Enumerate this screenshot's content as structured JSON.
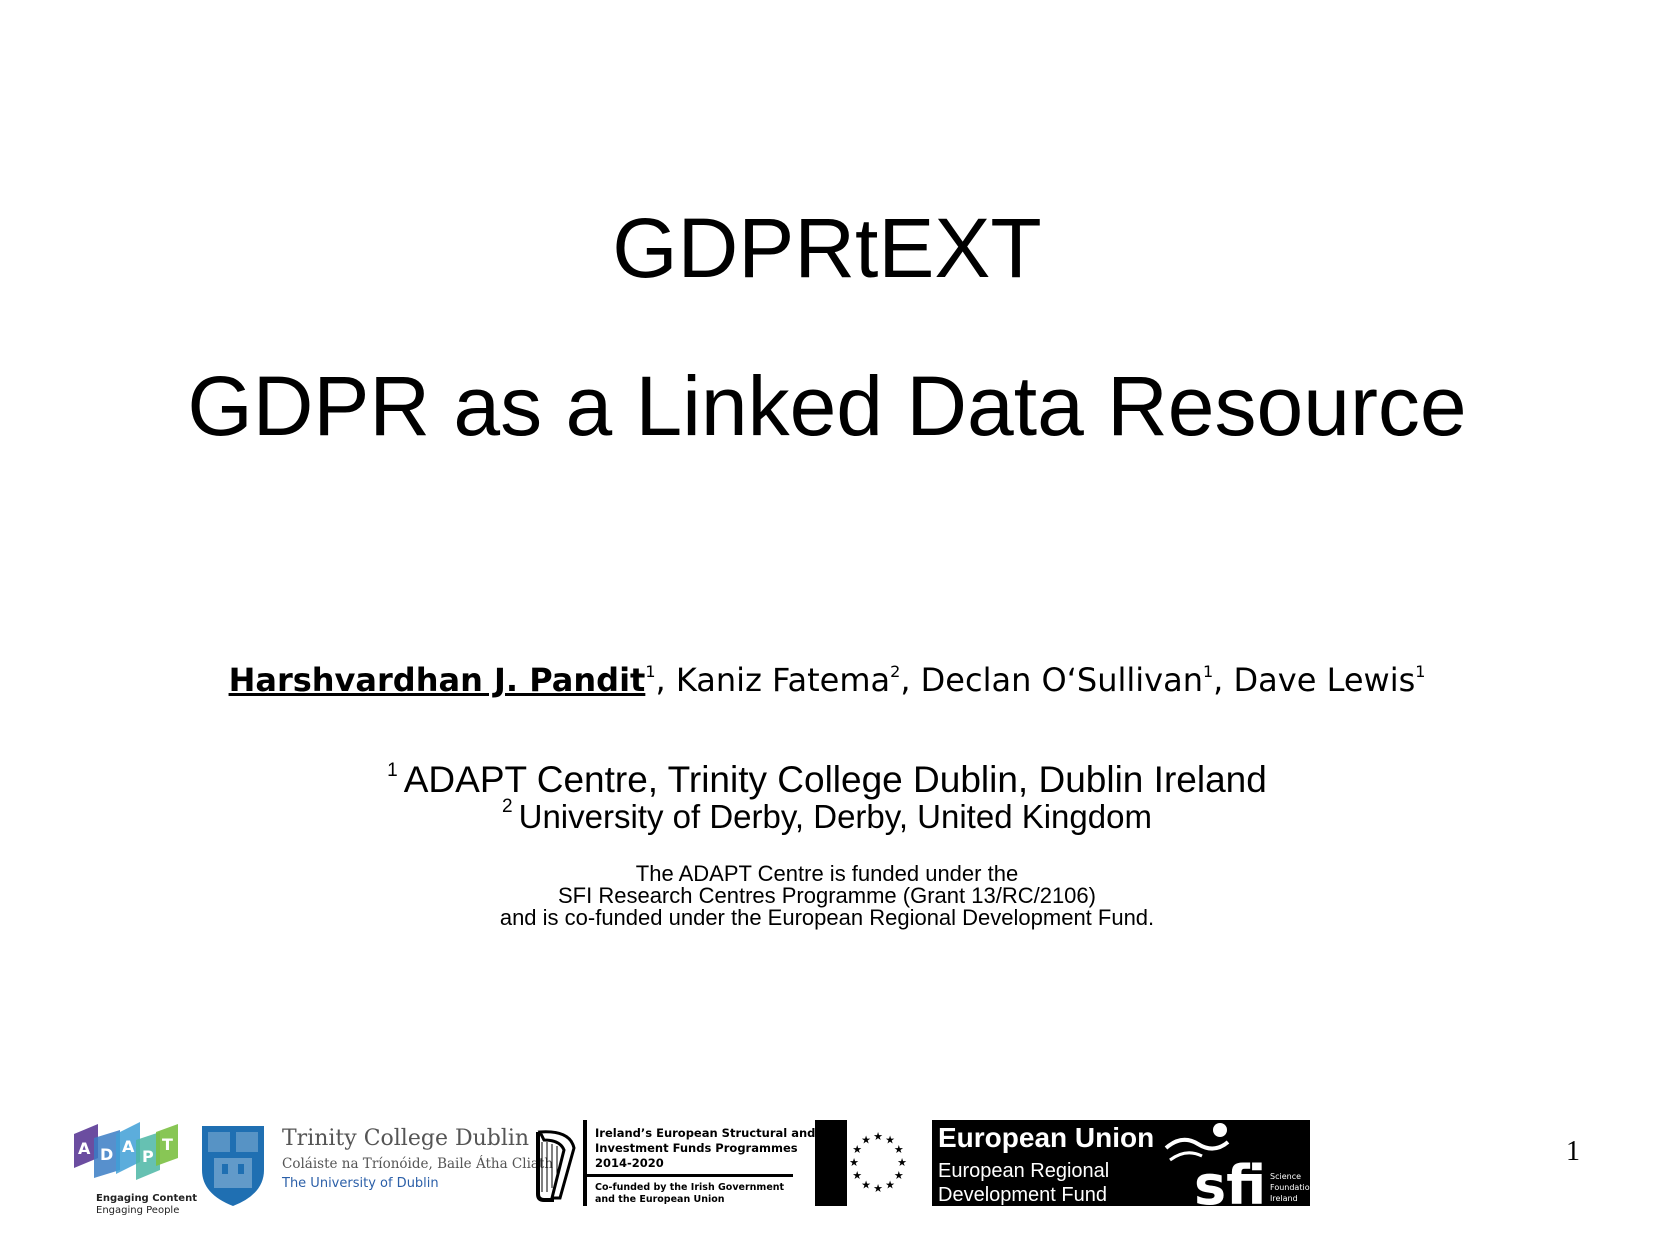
{
  "slide": {
    "title_line1": "GDPRtEXT",
    "title_line2": "GDPR as a Linked Data Resource",
    "authors": [
      {
        "name": "Harshvardhan J. Pandit",
        "affil": "1",
        "sep": ", "
      },
      {
        "name": "Kaniz Fatema",
        "affil": "2",
        "sep": ", "
      },
      {
        "name": "Declan O‘Sullivan",
        "affil": "1",
        "sep": ", "
      },
      {
        "name": "Dave Lewis",
        "affil": "1",
        "sep": ""
      }
    ],
    "affiliations": [
      {
        "marker": "1",
        "text": "ADAPT Centre, Trinity College Dublin, Dublin Ireland"
      },
      {
        "marker": "2",
        "text": "University of Derby, Derby, United Kingdom"
      }
    ],
    "funding": [
      "The ADAPT Centre is funded under the",
      "SFI Research Centres Programme (Grant 13/RC/2106)",
      "and is co-funded under the European Regional Development Fund."
    ],
    "page_number": "1"
  },
  "logos": {
    "adapt": {
      "letters": [
        "A",
        "D",
        "A",
        "P",
        "T"
      ],
      "tagline1": "Engaging Content",
      "tagline2": "Engaging People"
    },
    "tcd": {
      "name": "Trinity College Dublin",
      "irish": "Coláiste na Tríonóide, Baile Átha Cliath",
      "university": "The University of Dublin"
    },
    "esif": {
      "line1": "Ireland’s European Structural and",
      "line2": "Investment Funds Programmes",
      "line3": "2014-2020",
      "line4": "Co-funded by the Irish Government",
      "line5": "and the European Union"
    },
    "erdf": {
      "title": "European Union",
      "line1": "European Regional",
      "line2": "Development Fund"
    },
    "sfi": {
      "wordmark": "sfi",
      "line1": "Science",
      "line2": "Foundation",
      "line3": "Ireland"
    }
  },
  "colors": {
    "text": "#000000",
    "background": "#ffffff",
    "adapt_purple": "#5b3a96",
    "adapt_blue": "#3a7cc4",
    "adapt_green": "#7bc043",
    "tcd_blue": "#1f6fb2",
    "tcd_grey": "#555555"
  }
}
